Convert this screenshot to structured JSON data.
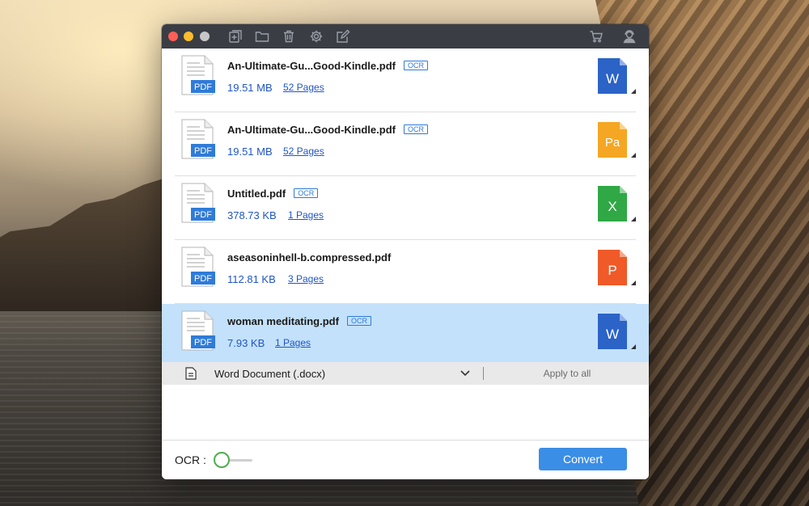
{
  "colors": {
    "accent": "#3a8ee6",
    "link": "#1f55c8",
    "selected_row": "#c3e1fb",
    "titlebar": "#3a3d44",
    "toggle_green": "#4cae4c"
  },
  "titlebar": {
    "icons": [
      "add-file-icon",
      "folder-icon",
      "trash-icon",
      "gear-icon",
      "edit-icon",
      "cart-icon",
      "support-icon"
    ]
  },
  "files": [
    {
      "name": "An-Ultimate-Gu...Good-Kindle.pdf",
      "ocr_badge": "OCR",
      "size": "19.51 MB",
      "pages": "52 Pages",
      "file_icon_label": "PDF",
      "output_format": "word",
      "output_icon_label": "W",
      "output_color": "#2b63c7",
      "selected": false
    },
    {
      "name": "An-Ultimate-Gu...Good-Kindle.pdf",
      "ocr_badge": "OCR",
      "size": "19.51 MB",
      "pages": "52 Pages",
      "file_icon_label": "PDF",
      "output_format": "pages",
      "output_icon_label": "Pa",
      "output_color": "#f5a623",
      "selected": false
    },
    {
      "name": "Untitled.pdf",
      "ocr_badge": "OCR",
      "size": "378.73 KB",
      "pages": "1 Pages",
      "file_icon_label": "PDF",
      "output_format": "excel",
      "output_icon_label": "X",
      "output_color": "#2fa845",
      "selected": false
    },
    {
      "name": "aseasoninhell-b.compressed.pdf",
      "ocr_badge": "",
      "size": "112.81 KB",
      "pages": "3 Pages",
      "file_icon_label": "PDF",
      "output_format": "powerpoint",
      "output_icon_label": "P",
      "output_color": "#ef5a28",
      "selected": false
    },
    {
      "name": "woman meditating.pdf",
      "ocr_badge": "OCR",
      "size": "7.93 KB",
      "pages": "1 Pages",
      "file_icon_label": "PDF",
      "output_format": "word",
      "output_icon_label": "W",
      "output_color": "#2b63c7",
      "selected": true
    }
  ],
  "format_bar": {
    "selected_format": "Word Document (.docx)",
    "apply_label": "Apply to all"
  },
  "bottom": {
    "ocr_label": "OCR :",
    "ocr_enabled": false,
    "convert_label": "Convert"
  }
}
